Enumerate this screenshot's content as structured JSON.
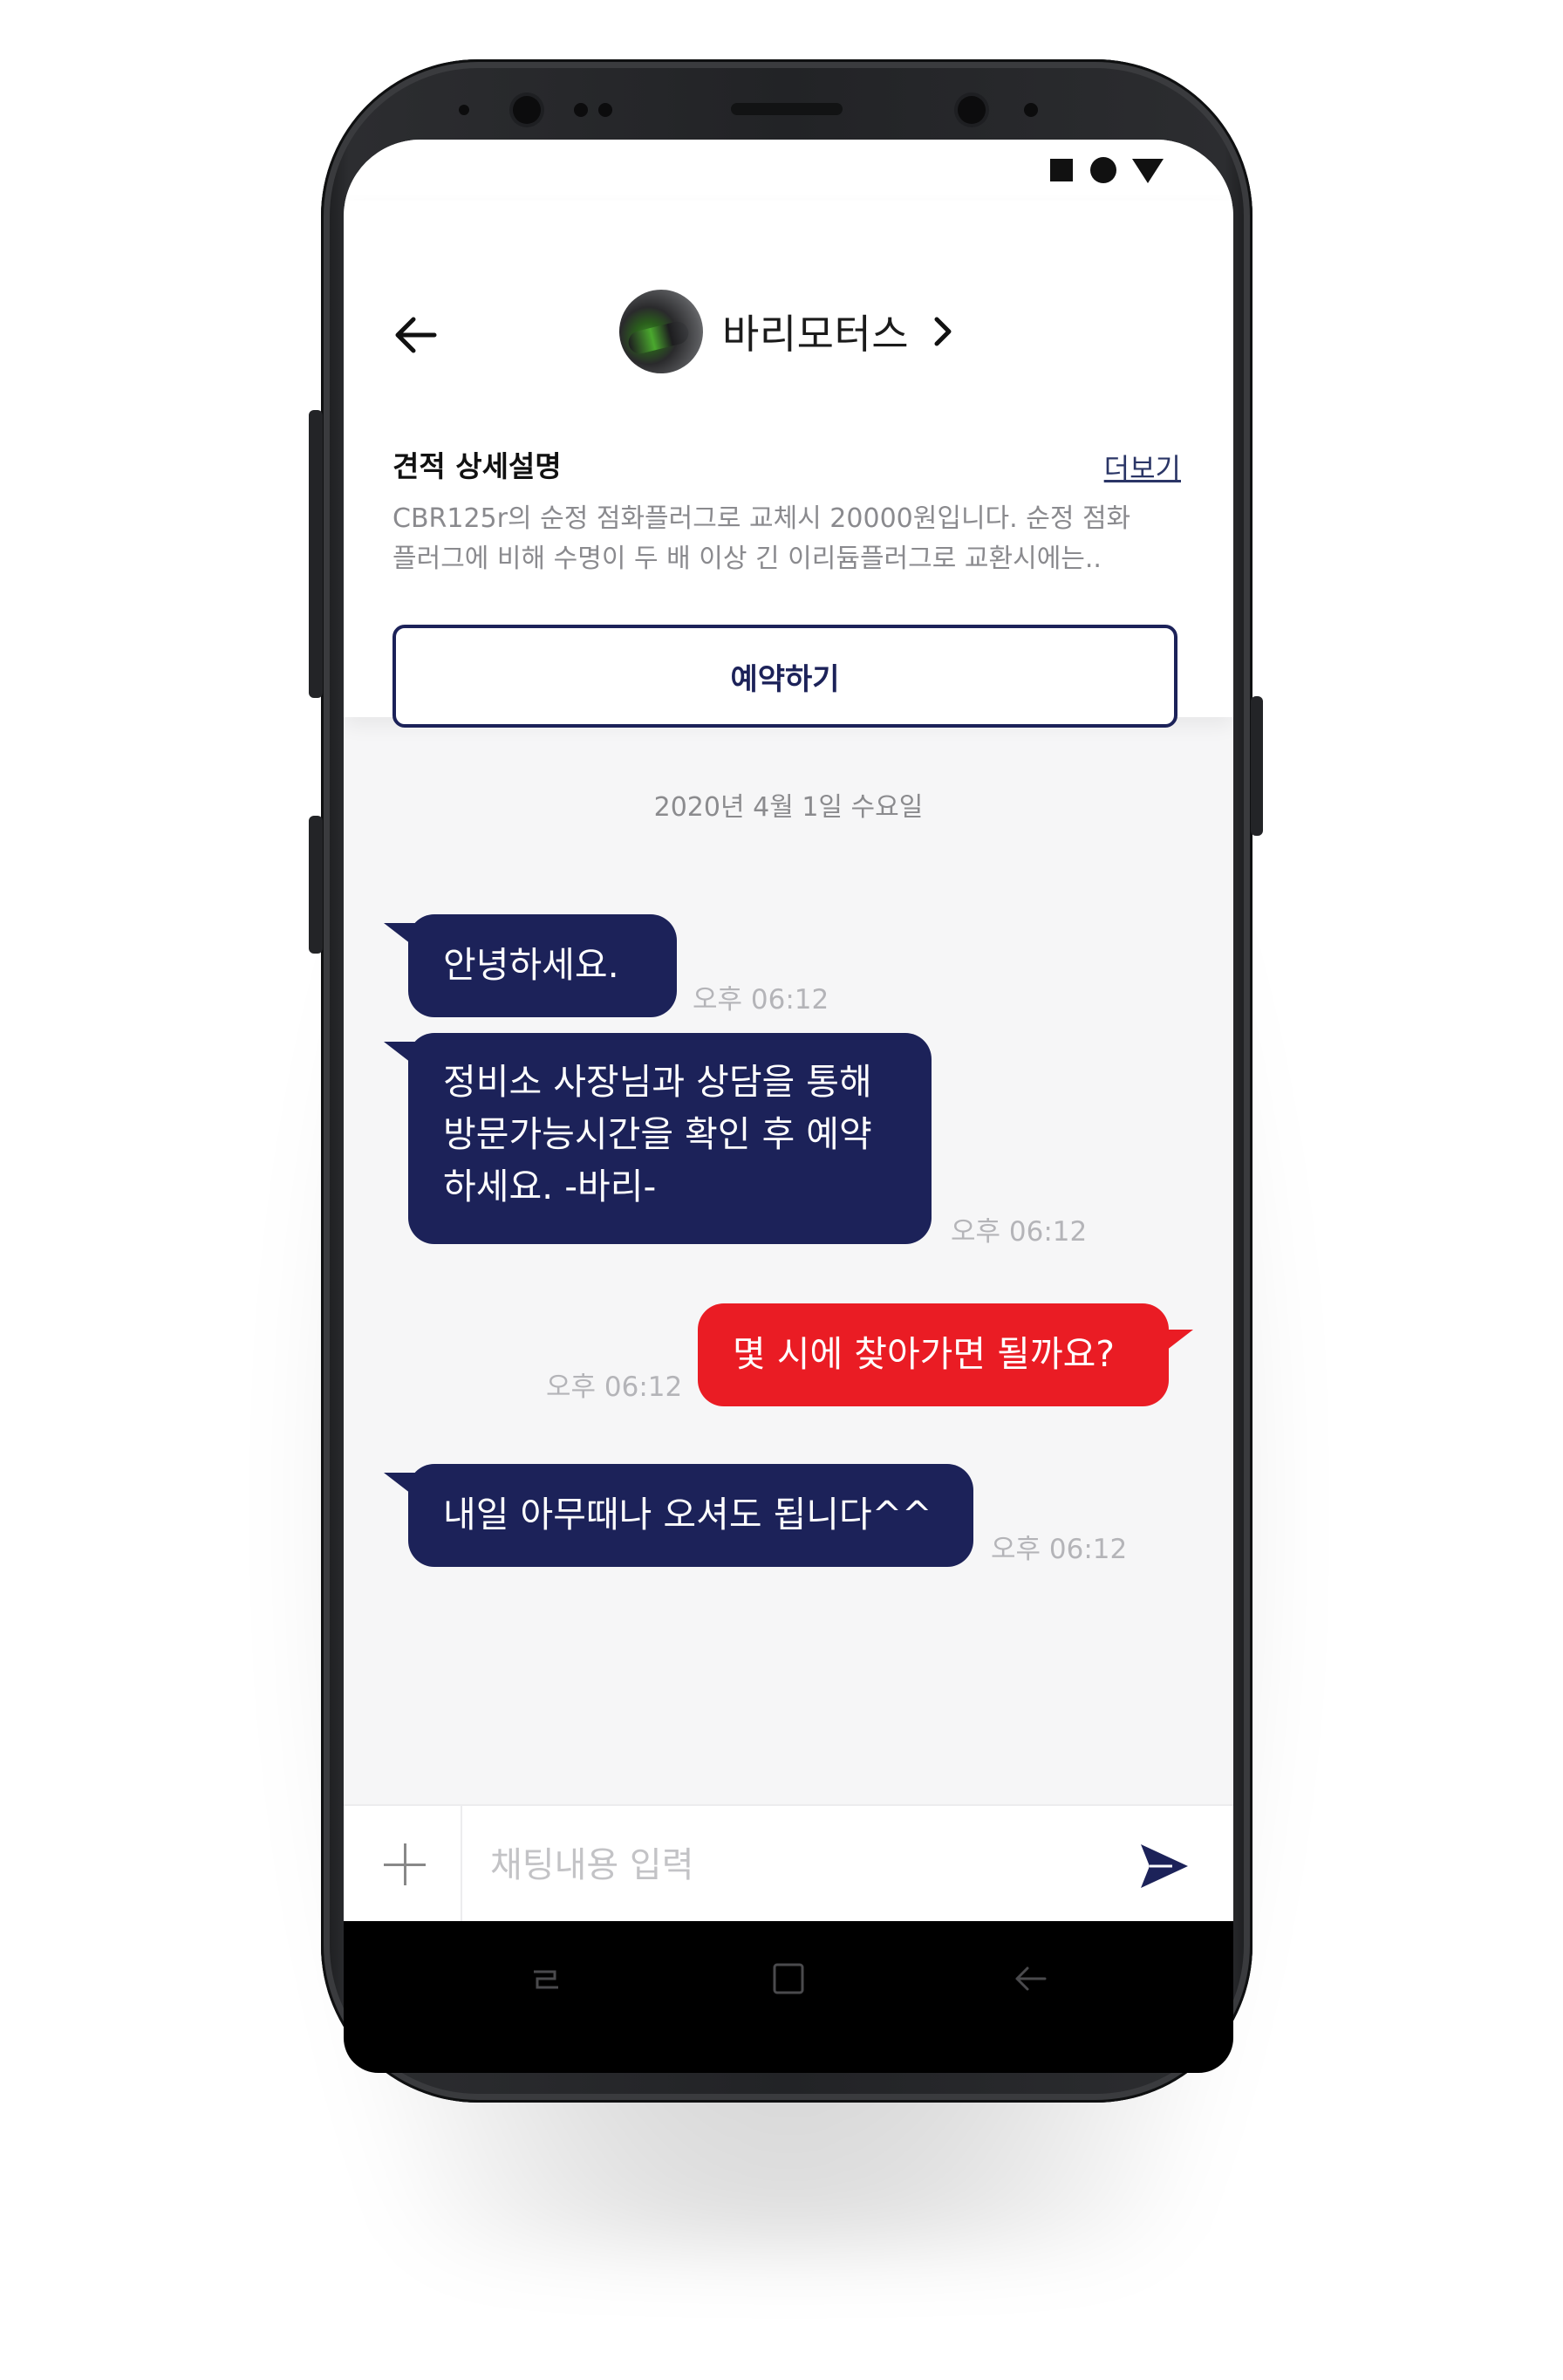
{
  "status_bar": {
    "icons": [
      "square-icon",
      "circle-icon",
      "triangle-icon"
    ]
  },
  "header": {
    "shop_name": "바리모터스",
    "avatar_icon": "motorcycle-avatar",
    "back_icon": "arrow-left-icon",
    "chevron_icon": "chevron-right-icon"
  },
  "estimate": {
    "title": "견적 상세설명",
    "more_label": "더보기",
    "description_line1": "CBR125r의 순정 점화플러그로 교체시 20000원입니다. 순정 점화",
    "description_line2": "플러그에 비해 수명이 두 배 이상 긴 이리듐플러그로 교환시에는..",
    "reserve_label": "예약하기"
  },
  "chat": {
    "date": "2020년 4월 1일 수요일",
    "messages": [
      {
        "direction": "in",
        "lines": [
          "안녕하세요."
        ],
        "time": "오후 06:12"
      },
      {
        "direction": "in",
        "lines": [
          "정비소 사장님과 상담을 통해",
          "방문가능시간을 확인 후 예약",
          "하세요. -바리-"
        ],
        "time": "오후 06:12"
      },
      {
        "direction": "out",
        "lines": [
          "몇 시에 찾아가면 될까요?"
        ],
        "time": "오후 06:12"
      },
      {
        "direction": "in",
        "lines": [
          "내일 아무때나 오셔도 됩니다^^"
        ],
        "time": "오후 06:12"
      }
    ]
  },
  "composer": {
    "placeholder": "채팅내용 입력",
    "plus_icon": "plus-icon",
    "send_icon": "send-icon"
  },
  "nav": {
    "icons": [
      "recent-apps-icon",
      "home-icon",
      "back-nav-icon"
    ]
  },
  "colors": {
    "navy": "#1c2259",
    "red": "#ea1c24",
    "chat_bg": "#f6f6f7"
  }
}
